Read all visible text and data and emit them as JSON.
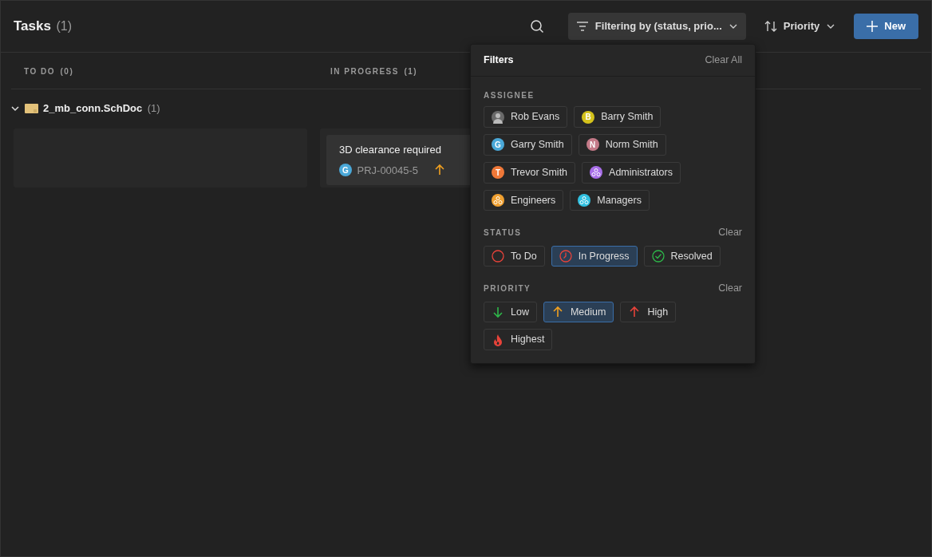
{
  "header": {
    "title": "Tasks",
    "count": "(1)",
    "filter_label": "Filtering by (status, prio...",
    "sort_label": "Priority",
    "new_label": "New"
  },
  "columns": [
    {
      "title": "TO DO",
      "count": "(0)"
    },
    {
      "title": "IN PROGRESS",
      "count": "(1)",
      "cards": [
        {
          "title": "3D clearance required",
          "avatar": {
            "letter": "G",
            "color": "#4aa8d8"
          },
          "id": "PRJ-00045-5",
          "priority": {
            "kind": "up",
            "color": "#f0a020"
          }
        }
      ]
    }
  ],
  "group": {
    "name": "2_mb_conn.SchDoc",
    "count": "(1)",
    "expanded": true
  },
  "filters": {
    "title": "Filters",
    "clear_all": "Clear All",
    "assignee": {
      "title": "ASSIGNEE",
      "items": [
        {
          "kind": "photo",
          "label": "Rob Evans",
          "selected": false
        },
        {
          "kind": "letter",
          "letter": "B",
          "color": "#d4c21c",
          "label": "Barry Smith",
          "selected": false
        },
        {
          "kind": "letter",
          "letter": "G",
          "color": "#4aa8d8",
          "label": "Garry Smith",
          "selected": false
        },
        {
          "kind": "letter",
          "letter": "N",
          "color": "#c47a88",
          "label": "Norm Smith",
          "selected": false
        },
        {
          "kind": "letter",
          "letter": "T",
          "color": "#f07838",
          "label": "Trevor Smith",
          "selected": false
        },
        {
          "kind": "group",
          "color": "#a86ee8",
          "label": "Administrators",
          "selected": false
        },
        {
          "kind": "group",
          "color": "#f0a030",
          "label": "Engineers",
          "selected": false
        },
        {
          "kind": "group",
          "color": "#30c0e0",
          "label": "Managers",
          "selected": false
        }
      ]
    },
    "status": {
      "title": "STATUS",
      "clear": "Clear",
      "items": [
        {
          "kind": "todo",
          "label": "To Do",
          "selected": false
        },
        {
          "kind": "progress",
          "label": "In Progress",
          "selected": true
        },
        {
          "kind": "resolved",
          "label": "Resolved",
          "selected": false
        }
      ]
    },
    "priority": {
      "title": "PRIORITY",
      "clear": "Clear",
      "items": [
        {
          "kind": "down",
          "color": "#2eb84a",
          "label": "Low",
          "selected": false
        },
        {
          "kind": "up",
          "color": "#f0a020",
          "label": "Medium",
          "selected": true
        },
        {
          "kind": "up",
          "color": "#e8433a",
          "label": "High",
          "selected": false
        },
        {
          "kind": "fire",
          "color": "#e8433a",
          "label": "Highest",
          "selected": false
        }
      ]
    }
  }
}
